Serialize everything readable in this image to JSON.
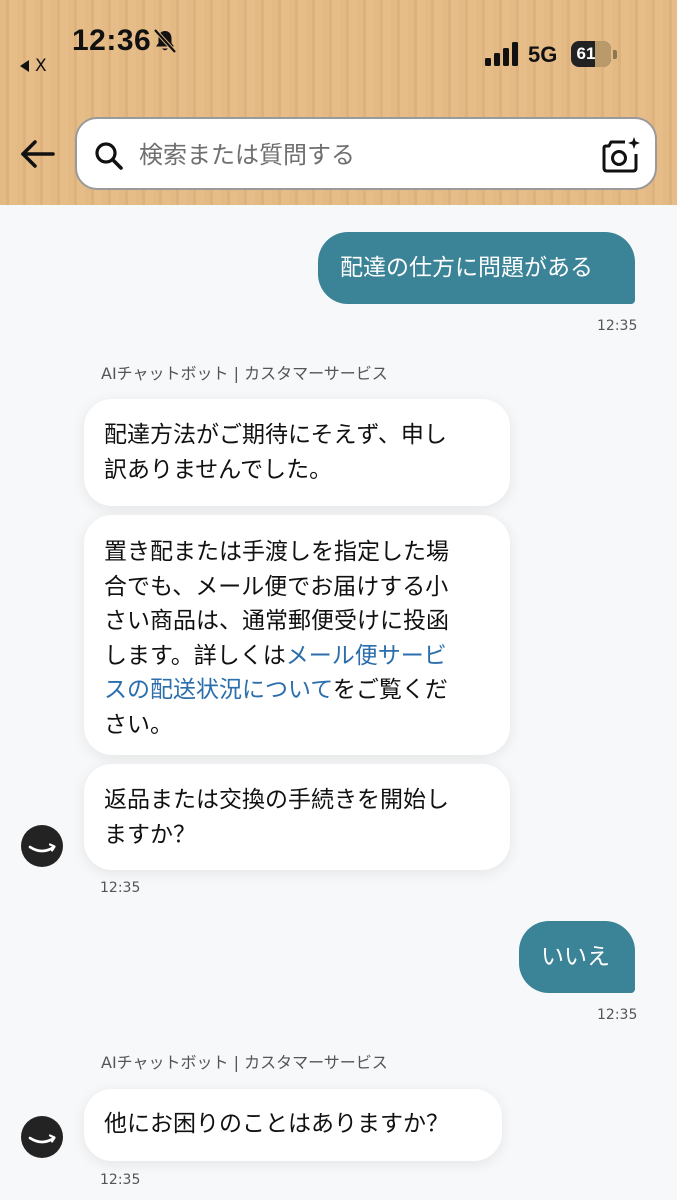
{
  "status_bar": {
    "time": "12:36",
    "back_app": "X",
    "network": "5G",
    "battery": "61",
    "battery_level": 0.61
  },
  "search": {
    "placeholder": "検索または質問する"
  },
  "chat": {
    "sender_label": "AIチャットボット | カスタマーサービス",
    "messages": [
      {
        "from": "user",
        "text": "配達の仕方に問題がある",
        "time": "12:35"
      },
      {
        "from": "bot",
        "text_1": "配達方法がご期待にそえず、申し",
        "text_2": "訳ありませんでした。"
      },
      {
        "from": "bot",
        "line_1": "置き配または手渡しを指定した場",
        "line_2": "合でも、メール便でお届けする小",
        "line_3": "さい商品は、通常郵便受けに投函",
        "line_4_pre": "します。詳しくは",
        "link_text_1": "メール便サービ",
        "link_text_2": "スの配送状況について",
        "line_5_post": "をご覧くだ",
        "line_6": "さい。"
      },
      {
        "from": "bot",
        "line_1": "返品または交換の手続きを開始し",
        "line_2": "ますか？",
        "time": "12:35"
      },
      {
        "from": "user",
        "text": "いいえ",
        "time": "12:35"
      },
      {
        "from": "bot",
        "text": "他にお困りのことはありますか？",
        "time": "12:35"
      }
    ]
  }
}
